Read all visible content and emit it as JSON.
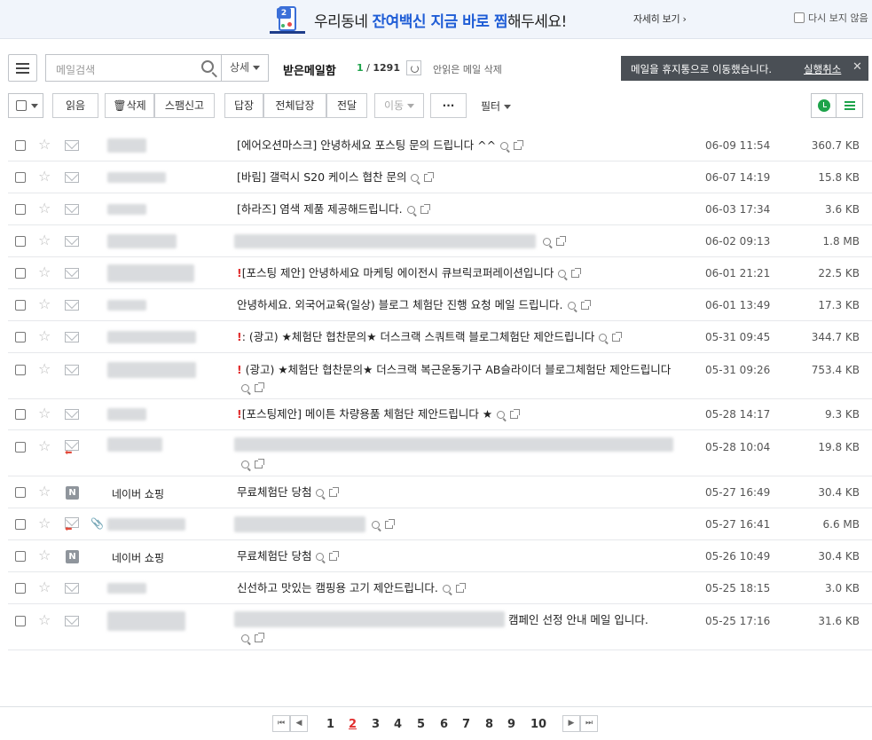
{
  "banner": {
    "text_pre": "우리동네 ",
    "text_hl": "잔여백신 지금 바로 찜",
    "text_post": "해두세요!",
    "detail": "자세히 보기 ›",
    "hide": "다시 보지 않음"
  },
  "toolbar": {
    "search_placeholder": "메일검색",
    "detail": "상세",
    "folder": "받은메일함",
    "count_current": "1",
    "count_total": "1291",
    "unread_delete": "안읽은 메일 삭제",
    "read": "읽음",
    "delete": "삭제",
    "spam": "스팸신고",
    "reply": "답장",
    "reply_all": "전체답장",
    "forward": "전달",
    "move": "이동",
    "more": "···",
    "filter": "필터"
  },
  "toast": {
    "message": "메일을 휴지통으로 이동했습니다.",
    "undo": "실행취소",
    "close": "✕"
  },
  "rows": [
    {
      "sender": "",
      "subject": "[에어오션마스크] 안녕하세요 포스팅 문의 드립니다 ^^",
      "date": "06-09 11:54",
      "size": "360.7 KB"
    },
    {
      "sender": "",
      "subject": "[바림] 갤럭시 S20 케이스 협찬 문의",
      "date": "06-07 14:19",
      "size": "15.8 KB"
    },
    {
      "sender": "",
      "subject": "[하라즈] 염색 제품 제공해드립니다.",
      "date": "06-03 17:34",
      "size": "3.6 KB"
    },
    {
      "sender": "",
      "subject": "",
      "date": "06-02 09:13",
      "size": "1.8 MB"
    },
    {
      "sender": "",
      "subject": "[포스팅 제안] 안녕하세요 마케팅 에이전시 큐브릭코퍼레이션입니다",
      "date": "06-01 21:21",
      "size": "22.5 KB",
      "important": "!"
    },
    {
      "sender": "",
      "subject": "안녕하세요. 외국어교육(일상) 블로그 체험단 진행 요청 메일 드립니다.",
      "date": "06-01 13:49",
      "size": "17.3 KB"
    },
    {
      "sender": "",
      "subject": ": (광고) ★체험단 협찬문의★ 더스크랙 스쿼트랙 블로그체험단 제안드립니다",
      "date": "05-31 09:45",
      "size": "344.7 KB",
      "important": "!"
    },
    {
      "sender": "",
      "subject": " (광고) ★체험단 협찬문의★ 더스크랙 복근운동기구 AB슬라이더 블로그체험단 제안드립니다",
      "date": "05-31 09:26",
      "size": "753.4 KB",
      "important": "!"
    },
    {
      "sender": "",
      "subject": "[포스팅제안] 메이튼 차량용품 체험단 제안드립니다 ★",
      "date": "05-28 14:17",
      "size": "9.3 KB",
      "important": "!"
    },
    {
      "sender": "",
      "subject": "",
      "date": "05-28 10:04",
      "size": "19.8 KB"
    },
    {
      "sender": "네이버 쇼핑",
      "subject": "무료체험단 당첨",
      "date": "05-27 16:49",
      "size": "30.4 KB"
    },
    {
      "sender": "",
      "subject": "",
      "date": "05-27 16:41",
      "size": "6.6 MB"
    },
    {
      "sender": "네이버 쇼핑",
      "subject": "무료체험단 당첨",
      "date": "05-26 10:49",
      "size": "30.4 KB"
    },
    {
      "sender": "",
      "subject": "신선하고 맛있는 캠핑용 고기 제안드립니다.",
      "date": "05-25 18:15",
      "size": "3.0 KB"
    },
    {
      "sender": "",
      "subject": "캠페인 선정 안내 메일 입니다.",
      "date": "05-25 17:16",
      "size": "31.6 KB"
    }
  ],
  "pagination": {
    "pages": [
      "1",
      "2",
      "3",
      "4",
      "5",
      "6",
      "7",
      "8",
      "9",
      "10"
    ],
    "current": "2",
    "first": "⏮",
    "prev": "◀",
    "next": "▶",
    "last": "⏭"
  },
  "icons": {
    "star": "☆",
    "naver": "N",
    "reply_arrow": "⬅",
    "clip": "📎"
  },
  "colors": {
    "accent_green": "#1da34a",
    "important_red": "#e12d2d",
    "banner_blue": "#1f5dd6",
    "toast_bg": "#4a4f55"
  }
}
